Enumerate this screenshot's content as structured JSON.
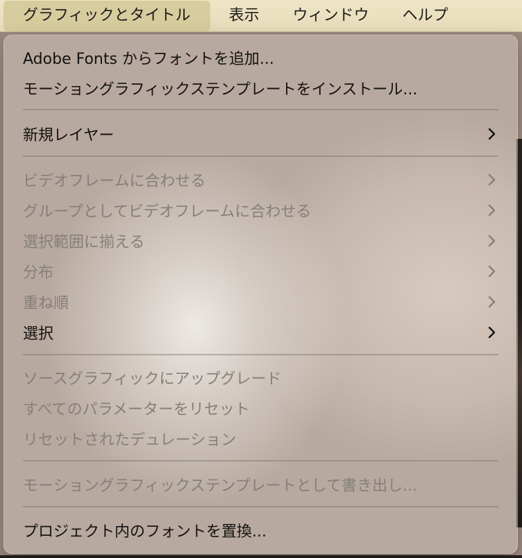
{
  "menubar": {
    "items": [
      {
        "label": "グラフィックとタイトル",
        "active": true
      },
      {
        "label": "表示",
        "active": false
      },
      {
        "label": "ウィンドウ",
        "active": false
      },
      {
        "label": "ヘルプ",
        "active": false
      }
    ]
  },
  "menu": {
    "add_fonts": "Adobe Fonts からフォントを追加...",
    "install_template": "モーショングラフィックステンプレートをインストール...",
    "new_layer": "新規レイヤー",
    "fit_video_frame": "ビデオフレームに合わせる",
    "fit_group_video_frame": "グループとしてビデオフレームに合わせる",
    "align_selection": "選択範囲に揃える",
    "distribute": "分布",
    "arrange": "重ね順",
    "select": "選択",
    "upgrade_source_graphic": "ソースグラフィックにアップグレード",
    "reset_all_params": "すべてのパラメーターをリセット",
    "reset_duration": "リセットされたデュレーション",
    "export_template": "モーショングラフィックステンプレートとして書き出し...",
    "replace_fonts": "プロジェクト内のフォントを置換..."
  },
  "colors": {
    "menubar_bg": "#ece3c3",
    "active_item_bg": "#d7cc9e",
    "enabled_text": "#141210",
    "disabled_text": "#857f79"
  },
  "icons": {
    "submenu": "chevron-right-icon"
  }
}
